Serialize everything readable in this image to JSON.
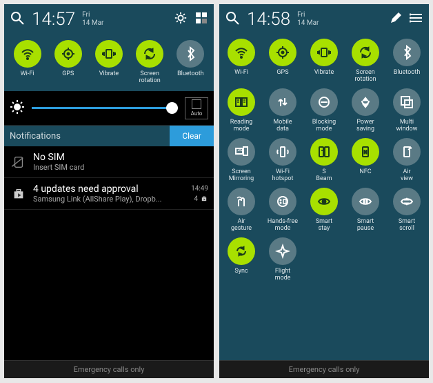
{
  "left": {
    "time": "14:57",
    "day": "Fri",
    "date": "14 Mar",
    "toggles": [
      {
        "label": "Wi-Fi",
        "on": true,
        "icon": "wifi"
      },
      {
        "label": "GPS",
        "on": true,
        "icon": "gps"
      },
      {
        "label": "Vibrate",
        "on": true,
        "icon": "vibrate"
      },
      {
        "label": "Screen rotation",
        "on": true,
        "icon": "rotate"
      },
      {
        "label": "Bluetooth",
        "on": false,
        "icon": "bluetooth"
      }
    ],
    "brightness": {
      "auto_label": "Auto"
    },
    "notif_header": {
      "title": "Notifications",
      "clear": "Clear"
    },
    "notifs": [
      {
        "title": "No SIM",
        "sub": "Insert SIM card",
        "time": "",
        "count": ""
      },
      {
        "title": "4 updates need approval",
        "sub": "Samsung Link (AllShare Play), Dropb...",
        "time": "14:49",
        "count": "4"
      }
    ],
    "footer": "Emergency calls only"
  },
  "right": {
    "time": "14:58",
    "day": "Fri",
    "date": "14 Mar",
    "toggles": [
      {
        "label": "Wi-Fi",
        "on": true,
        "icon": "wifi"
      },
      {
        "label": "GPS",
        "on": true,
        "icon": "gps"
      },
      {
        "label": "Vibrate",
        "on": true,
        "icon": "vibrate"
      },
      {
        "label": "Screen rotation",
        "on": true,
        "icon": "rotate"
      },
      {
        "label": "Bluetooth",
        "on": false,
        "icon": "bluetooth"
      },
      {
        "label": "Reading mode",
        "on": true,
        "icon": "reading"
      },
      {
        "label": "Mobile data",
        "on": false,
        "icon": "mobiledata"
      },
      {
        "label": "Blocking mode",
        "on": false,
        "icon": "blocking"
      },
      {
        "label": "Power saving",
        "on": false,
        "icon": "powersave"
      },
      {
        "label": "Multi window",
        "on": false,
        "icon": "multiwindow"
      },
      {
        "label": "Screen Mirroring",
        "on": false,
        "icon": "mirror"
      },
      {
        "label": "Wi-Fi hotspot",
        "on": false,
        "icon": "hotspot"
      },
      {
        "label": "S Beam",
        "on": true,
        "icon": "sbeam"
      },
      {
        "label": "NFC",
        "on": true,
        "icon": "nfc"
      },
      {
        "label": "Air view",
        "on": false,
        "icon": "airview"
      },
      {
        "label": "Air gesture",
        "on": false,
        "icon": "airgesture"
      },
      {
        "label": "Hands-free mode",
        "on": false,
        "icon": "handsfree"
      },
      {
        "label": "Smart stay",
        "on": true,
        "icon": "smartstay"
      },
      {
        "label": "Smart pause",
        "on": false,
        "icon": "smartpause"
      },
      {
        "label": "Smart scroll",
        "on": false,
        "icon": "smartscroll"
      },
      {
        "label": "Sync",
        "on": true,
        "icon": "sync"
      },
      {
        "label": "Flight mode",
        "on": false,
        "icon": "flight"
      }
    ],
    "footer": "Emergency calls only"
  }
}
